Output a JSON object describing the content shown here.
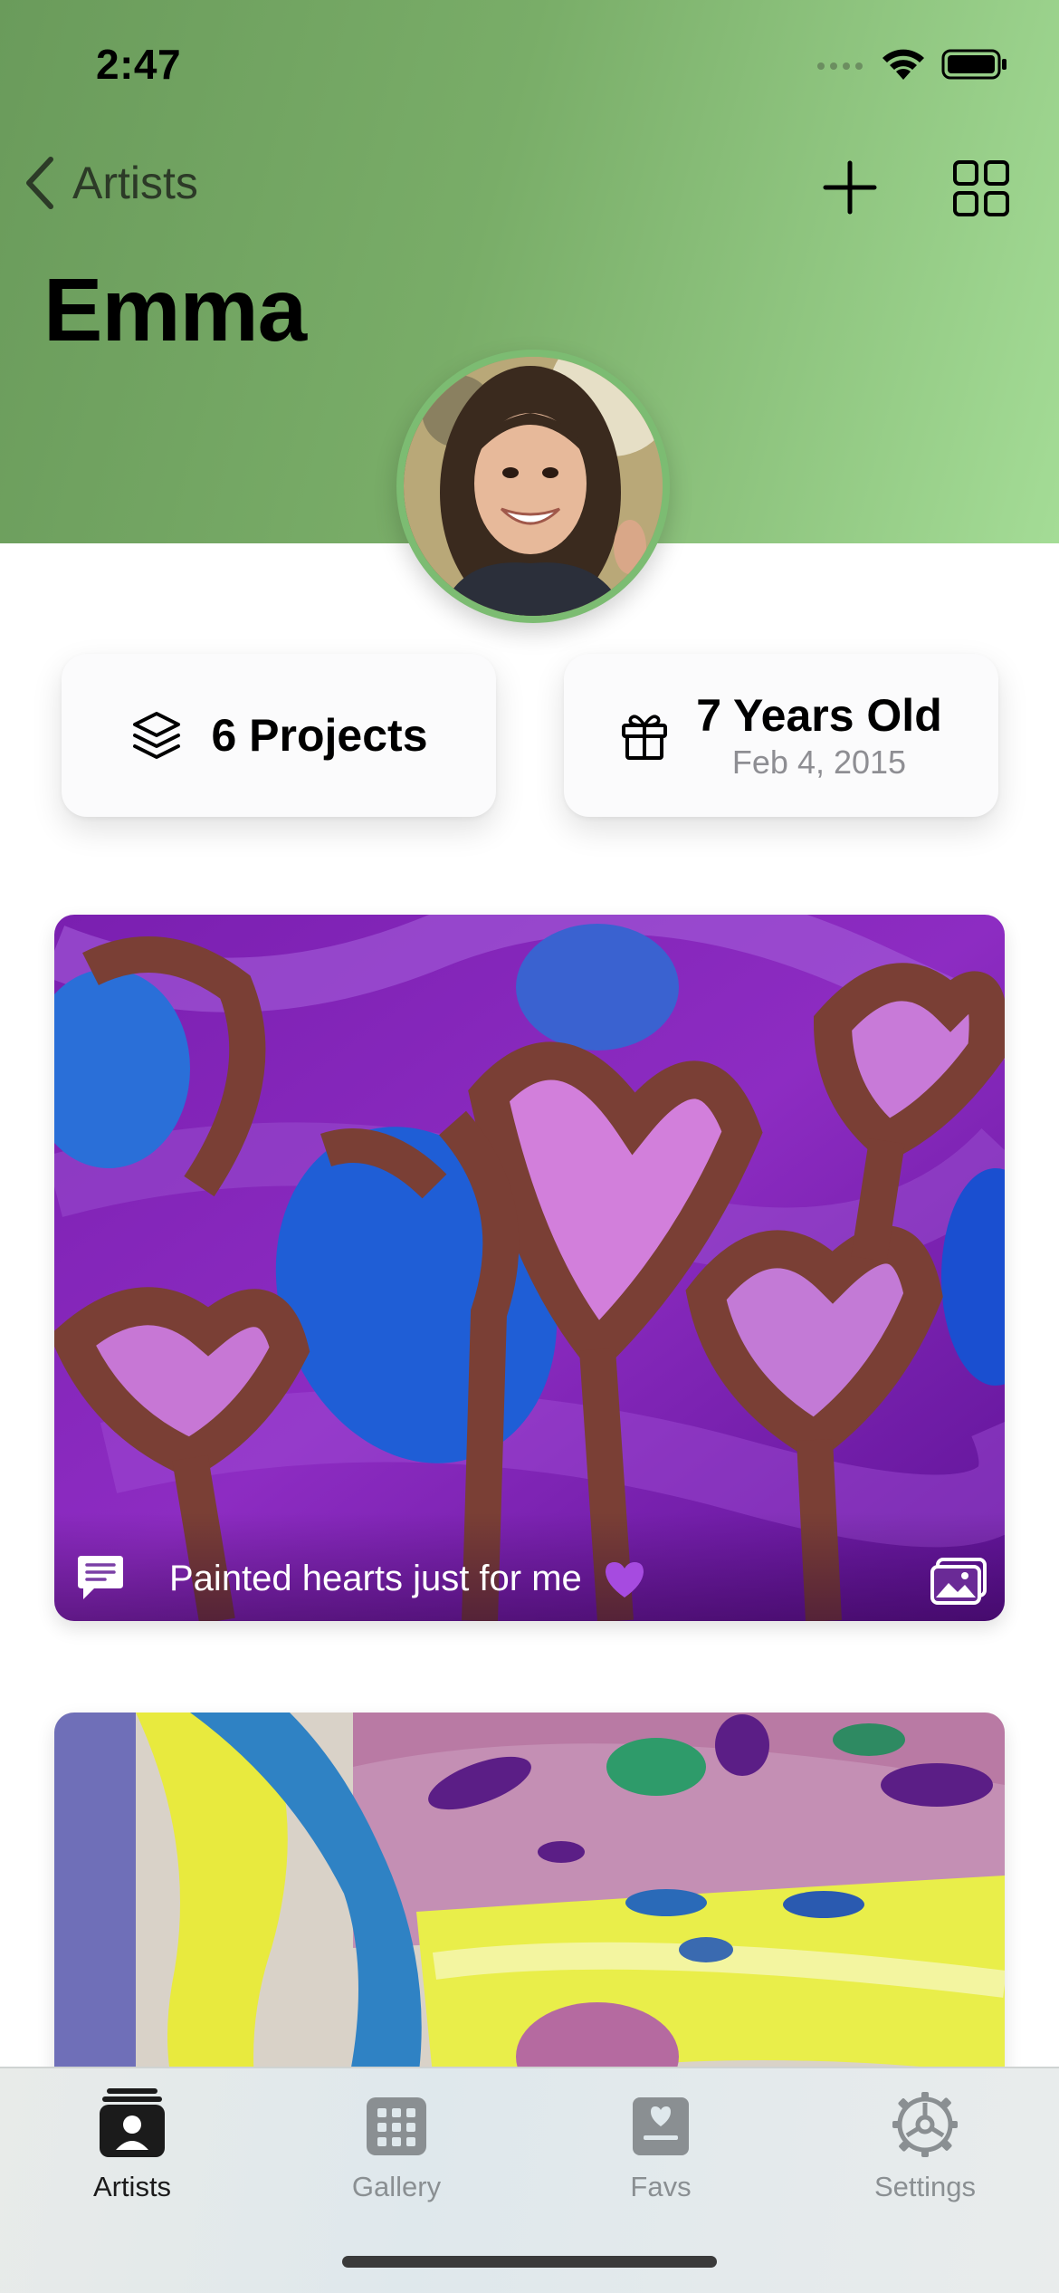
{
  "status_bar": {
    "time": "2:47"
  },
  "nav": {
    "back_label": "Artists",
    "title": "Emma"
  },
  "stats": {
    "projects_label": "6 Projects",
    "age_label": "7 Years Old",
    "birthdate": "Feb 4, 2015"
  },
  "artworks": [
    {
      "caption": "Painted hearts just for me"
    },
    {
      "caption": ""
    }
  ],
  "tabs": [
    {
      "label": "Artists",
      "active": true
    },
    {
      "label": "Gallery",
      "active": false
    },
    {
      "label": "Favs",
      "active": false
    },
    {
      "label": "Settings",
      "active": false
    }
  ],
  "colors": {
    "header_start": "#6a9b5b",
    "header_end": "#a4dc96",
    "avatar_ring": "#7cbc72"
  }
}
